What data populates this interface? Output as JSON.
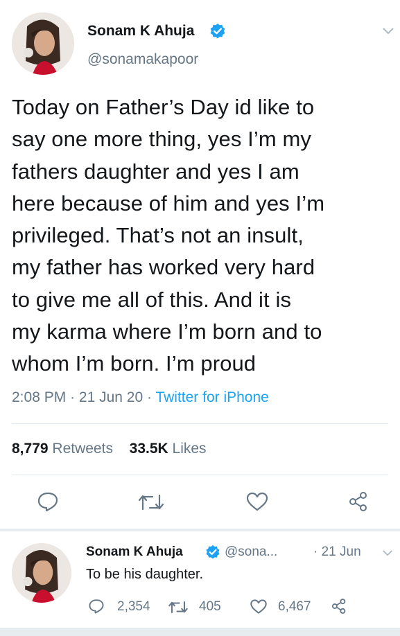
{
  "main_tweet": {
    "author_name": "Sonam K Ahuja",
    "handle": "@sonamakapoor",
    "lines": [
      "Today on Father’s Day id like to",
      "say one more thing, yes I’m my",
      "fathers daughter and yes I am",
      "here because of him and yes I’m",
      "privileged. That’s not an insult,",
      "my father has worked very hard",
      "to give me all of this. And it is",
      "my karma where I’m born and to",
      "whom I’m born. I’m proud"
    ],
    "time": "2:08 PM",
    "date": "21 Jun 20",
    "source": "Twitter for iPhone",
    "retweets_count": "8,779",
    "retweets_label": "Retweets",
    "likes_count": "33.5K",
    "likes_label": "Likes"
  },
  "reply_tweet": {
    "author_name": "Sonam K Ahuja",
    "handle": "@sona...",
    "date": "21 Jun",
    "text": "To be his daughter.",
    "replies": "2,354",
    "retweets": "405",
    "likes": "6,467"
  },
  "colors": {
    "accent": "#1da1f2",
    "muted": "#657786",
    "divider": "#e1e8ed"
  },
  "icons": [
    "reply-icon",
    "retweet-icon",
    "like-icon",
    "share-icon",
    "verified-badge-icon",
    "chevron-down-icon"
  ]
}
